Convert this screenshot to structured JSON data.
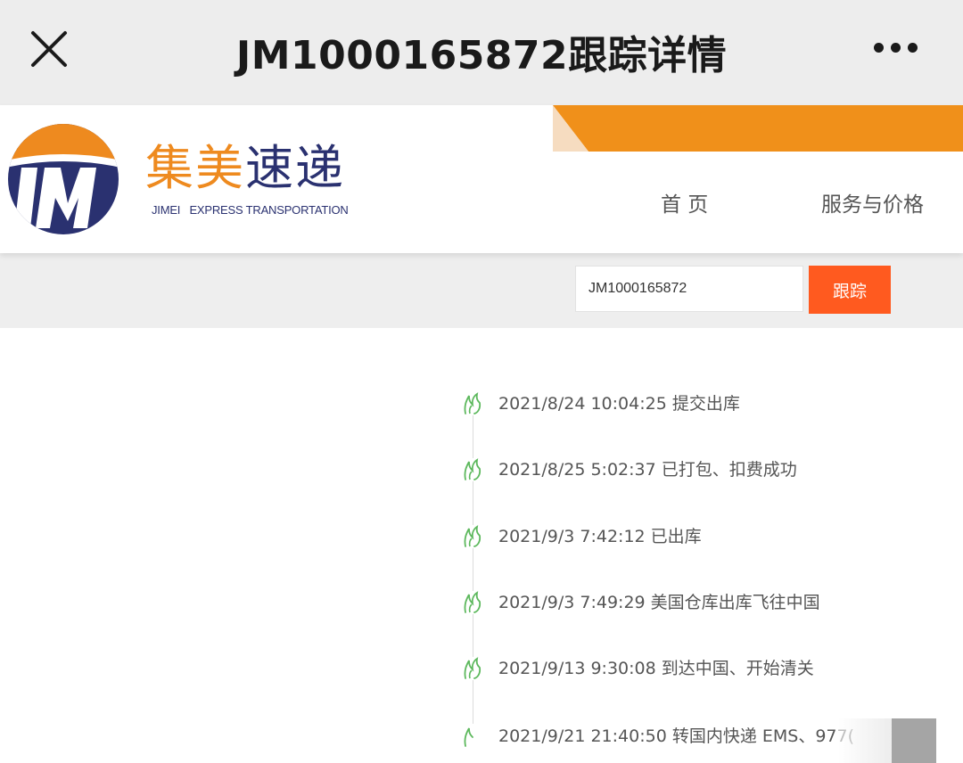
{
  "appbar": {
    "title": "JM1000165872跟踪详情",
    "close_icon": "close-icon",
    "more_icon": "more-dots-icon"
  },
  "site": {
    "logo_letters": "JM",
    "brand_cn_part1": "集美",
    "brand_cn_part2": "速递",
    "brand_en": "JIMEI   EXPRESS TRANSPORTATION",
    "nav": {
      "home": "首 页",
      "services": "服务与价格"
    },
    "colors": {
      "orange": "#ee8a1f",
      "navy": "#2a3170"
    }
  },
  "search": {
    "value": "JM1000165872",
    "button_label": "跟踪",
    "button_color": "#ff5a1f"
  },
  "timeline": {
    "icon": "sprout-icon",
    "icon_color": "#5cb85c",
    "events": [
      {
        "text": "2021/8/24 10:04:25 提交出库"
      },
      {
        "text": "2021/8/25 5:02:37 已打包、扣费成功"
      },
      {
        "text": "2021/9/3 7:42:12 已出库"
      },
      {
        "text": "2021/9/3 7:49:29 美国仓库出库飞往中国"
      },
      {
        "text": "2021/9/13 9:30:08 到达中国、开始清关"
      },
      {
        "text": "2021/9/21 21:40:50 转国内快递 EMS、977("
      }
    ]
  }
}
